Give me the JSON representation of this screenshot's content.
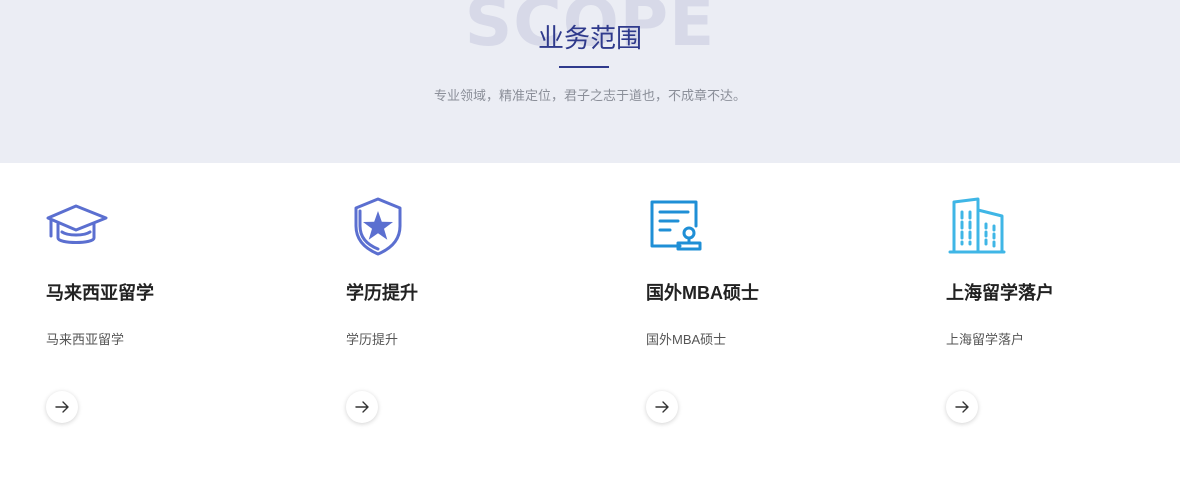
{
  "section": {
    "watermark": "SCOPE",
    "title": "业务范围",
    "subtitle": "专业领域，精准定位，君子之志于道也，不成章不达。"
  },
  "colors": {
    "accent": "#2f3a8c",
    "icon_purple": "#5b6fd0",
    "icon_blue": "#1f8fd6",
    "icon_cyan": "#3fb6e6"
  },
  "services": [
    {
      "icon": "graduation-cap-icon",
      "title": "马来西亚留学",
      "description": "马来西亚留学"
    },
    {
      "icon": "star-shield-icon",
      "title": "学历提升",
      "description": "学历提升"
    },
    {
      "icon": "certificate-stamp-icon",
      "title": "国外MBA硕士",
      "description": "国外MBA硕士"
    },
    {
      "icon": "building-icon",
      "title": "上海留学落户",
      "description": "上海留学落户"
    }
  ]
}
